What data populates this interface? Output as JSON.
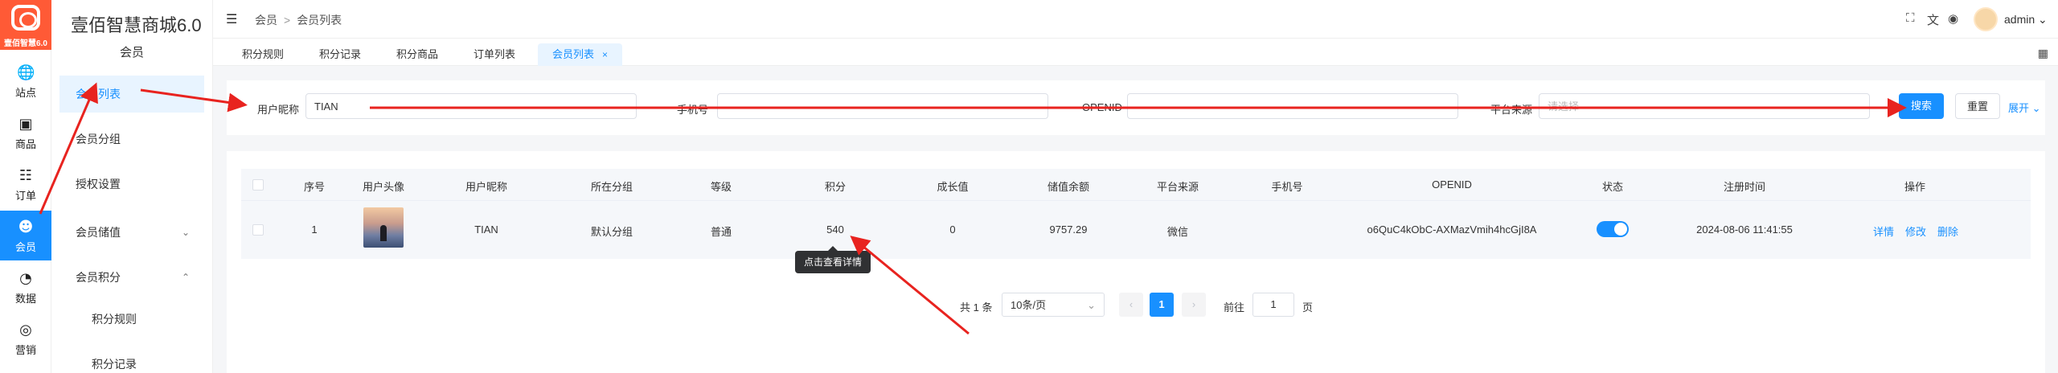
{
  "app": {
    "logo_version": "壹佰智慧6.0",
    "brand": "壹佰智慧商城6.0"
  },
  "rail": [
    {
      "label": "站点",
      "icon": "globe-icon"
    },
    {
      "label": "商品",
      "icon": "box-icon"
    },
    {
      "label": "订单",
      "icon": "clipboard-icon"
    },
    {
      "label": "会员",
      "icon": "user-icon"
    },
    {
      "label": "数据",
      "icon": "pie-chart-icon"
    },
    {
      "label": "营销",
      "icon": "target-icon"
    }
  ],
  "sidebar": {
    "section": "会员",
    "items": [
      "会员列表",
      "会员分组",
      "授权设置",
      "会员储值",
      "会员积分",
      "积分规则",
      "积分记录"
    ]
  },
  "header": {
    "breadcrumb": [
      "会员",
      "会员列表"
    ],
    "user": "admin"
  },
  "tabs": [
    "积分规则",
    "积分记录",
    "积分商品",
    "订单列表",
    "会员列表"
  ],
  "search": {
    "nickname_label": "用户昵称",
    "nickname_value": "TIAN",
    "phone_label": "手机号",
    "phone_placeholder": "",
    "openid_label": "OPENID",
    "openid_placeholder": "",
    "source_label": "平台来源",
    "source_placeholder": "请选择",
    "search_button": "搜索",
    "reset_button": "重置",
    "expand_link": "展开"
  },
  "table": {
    "columns": [
      "序号",
      "用户头像",
      "用户昵称",
      "所在分组",
      "等级",
      "积分",
      "成长值",
      "储值余额",
      "平台来源",
      "手机号",
      "OPENID",
      "状态",
      "注册时间",
      "操作"
    ],
    "rows": [
      {
        "index": "1",
        "nickname": "TIAN",
        "group": "默认分组",
        "level": "普通",
        "points": "540",
        "growth": "0",
        "balance": "9757.29",
        "source": "微信",
        "phone": "",
        "openid": "o6QuC4kObC-AXMazVmih4hcGjI8A",
        "status_on": true,
        "registered": "2024-08-06 11:41:55"
      }
    ],
    "actions": [
      "详情",
      "修改",
      "删除"
    ],
    "tooltip": "点击查看详情"
  },
  "pagination": {
    "total": "共 1 条",
    "page_size": "10条/页",
    "current": "1",
    "goto_label": "前往",
    "goto_value": "1",
    "page_unit": "页"
  },
  "annotation_color": "#e8231f"
}
